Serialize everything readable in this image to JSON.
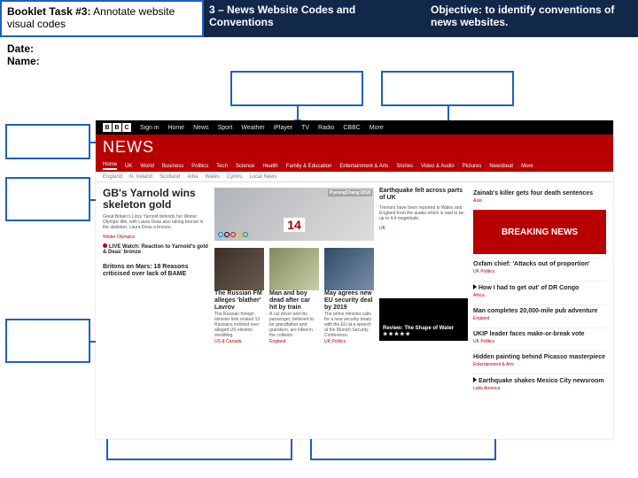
{
  "header": {
    "task_prefix": "Booklet Task #3:",
    "task_suffix": " Annotate website visual codes",
    "unit": "3 – News Website Codes and Conventions",
    "objective": "Objective: to identify conventions of news websites."
  },
  "meta": {
    "date": "Date:",
    "name": "Name:"
  },
  "blackbar": {
    "signin": "Sign in",
    "items": [
      "Home",
      "News",
      "Sport",
      "Weather",
      "iPlayer",
      "TV",
      "Radio",
      "CBBC",
      "More"
    ]
  },
  "news_logo": "NEWS",
  "cats": [
    "Home",
    "UK",
    "World",
    "Business",
    "Politics",
    "Tech",
    "Science",
    "Health",
    "Family & Education",
    "Entertainment & Arts",
    "Stories",
    "Video & Audio",
    "Pictures",
    "Newsbeat",
    "More"
  ],
  "subcats": [
    "England",
    "N. Ireland",
    "Scotland",
    "Alba",
    "Wales",
    "Cymru",
    "Local News"
  ],
  "lead": {
    "headline": "GB's Yarnold wins skeleton gold",
    "desc": "Great Britain's Lizzy Yarnold defends her Winter Olympic title, with Laura Deas also taking bronze in the skeleton. Laura Deas a bronze.",
    "tag": "Winter Olympics",
    "live_label": "LIVE",
    "live_text": "Watch: Reaction to Yarnold's gold & Deas' bronze",
    "sub_headline": "Britons on Mars: 18 Reasons criticised over lack of BAME",
    "olympics_label": "PyeongChang 2018",
    "bib": "14"
  },
  "colC": {
    "h": "Earthquake felt across parts of UK",
    "d": "Tremors have been reported in Wales and England from the quake which is said to be up to 4.4 magnitude.",
    "t": "UK"
  },
  "colD": {
    "top": {
      "h": "Zainab's killer gets four death sentences",
      "t": "Asia"
    },
    "breaking": "BREAKING NEWS",
    "items": [
      {
        "h": "Oxfam chief: 'Attacks out of proportion'",
        "t": "UK Politics"
      },
      {
        "h": "How I had to get out' of DR Congo",
        "t": "Africa",
        "video": true
      },
      {
        "h": "Man completes 20,000-mile pub adventure",
        "t": "England"
      },
      {
        "h": "UKIP leader faces make-or-break vote",
        "t": "UK Politics"
      },
      {
        "h": "Hidden painting behind Picasso masterpiece",
        "t": "Entertainment & Arts"
      },
      {
        "h": "Earthquake shakes Mexico City newsroom",
        "t": "Latin America",
        "video": true
      }
    ]
  },
  "row3": [
    {
      "h": "The Russian FM alleges 'blather' Lavrov",
      "d": "The Russian foreign minister lists related 13 Russians indicted over alleged US election meddling.",
      "t": "US & Canada"
    },
    {
      "h": "Man and boy dead after car hit by train",
      "d": "A car driver and his passenger, believed to be grandfather and grandson, are killed in the collision.",
      "t": "England"
    },
    {
      "h": "May agrees new EU security deal by 2019",
      "d": "The prime minister calls for a new security treaty with the EU at a speech at the Munich Security Conference.",
      "t": "UK Politics"
    }
  ],
  "review": {
    "title": "Review: The Shape of Water",
    "stars": "★★★★★"
  }
}
